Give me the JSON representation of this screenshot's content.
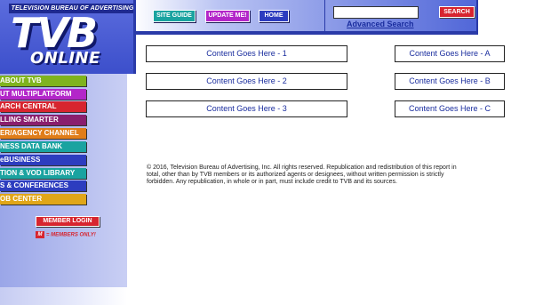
{
  "header": {
    "tagline": "TELEVISION BUREAU OF ADVERTISING",
    "logo_main": "TVB",
    "logo_sub": "ONLINE",
    "buttons": {
      "site_guide": "SITE GUIDE",
      "update_me": "UPDATE ME!",
      "home": "HOME"
    },
    "search": {
      "value": "",
      "button": "SEARCH",
      "advanced": "Advanced Search"
    }
  },
  "sidebar": {
    "items": [
      {
        "label": "ABOUT TVB",
        "color": "#7fb31e"
      },
      {
        "label": "UT MULTIPLATFORM",
        "color": "#b326c9"
      },
      {
        "label": "ARCH CENTRAL",
        "color": "#d7252f"
      },
      {
        "label": "LLING SMARTER",
        "color": "#8a1e6e"
      },
      {
        "label": "ER/AGENCY CHANNEL",
        "color": "#e07d19"
      },
      {
        "label": "NESS DATA BANK",
        "color": "#1aa3a0"
      },
      {
        "label": "eBUSINESS",
        "color": "#2d3dbf"
      },
      {
        "label": "TION & VOD LIBRARY",
        "color": "#1aa3a0"
      },
      {
        "label": "S & CONFERENCES",
        "color": "#2d3dbf"
      },
      {
        "label": "OB CENTER",
        "color": "#e0a619"
      }
    ],
    "member_login": "MEMBER LOGIN",
    "members_only_icon": "M",
    "members_only": "= MEMBERS ONLY!"
  },
  "content": {
    "left": [
      "Content Goes Here - 1",
      "Content Goes Here - 2",
      "Content Goes Here - 3"
    ],
    "right": [
      "Content Goes Here - A",
      "Content Goes Here - B",
      "Content Goes Here - C"
    ]
  },
  "footer": {
    "copyright": "© 2016, Television Bureau of Advertising, Inc. All rights reserved. Republication and redistribution of this report in total, other than by TVB members or its authorized agents or designees, without written permission is strictly forbidden. Any republication, in whole or in part, must include credit to TVB and its sources."
  }
}
